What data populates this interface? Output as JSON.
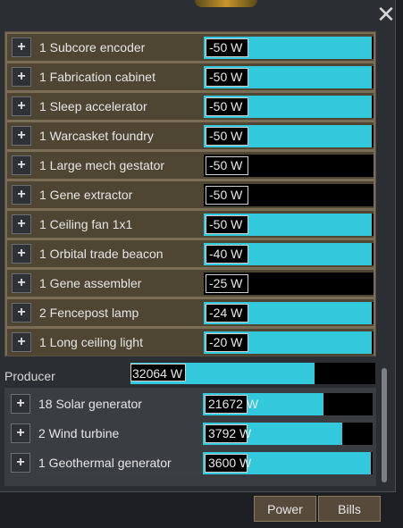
{
  "consumers": [
    {
      "label": "1 Subcore encoder",
      "value": "-50 W",
      "level": 1.0
    },
    {
      "label": "1 Fabrication cabinet",
      "value": "-50 W",
      "level": 1.0
    },
    {
      "label": "1 Sleep accelerator",
      "value": "-50 W",
      "level": 1.0
    },
    {
      "label": "1 Warcasket foundry",
      "value": "-50 W",
      "level": 1.0
    },
    {
      "label": "1 Large mech gestator",
      "value": "-50 W",
      "level": 0.0
    },
    {
      "label": "1 Gene extractor",
      "value": "-50 W",
      "level": 0.0
    },
    {
      "label": "1 Ceiling fan 1x1",
      "value": "-50 W",
      "level": 1.0
    },
    {
      "label": "1 Orbital trade beacon",
      "value": "-40 W",
      "level": 1.0
    },
    {
      "label": "1 Gene assembler",
      "value": "-25 W",
      "level": 0.0
    },
    {
      "label": "2 Fencepost lamp",
      "value": "-24 W",
      "level": 1.0
    },
    {
      "label": "1 Long ceiling light",
      "value": "-20 W",
      "level": 1.0
    }
  ],
  "producer": {
    "label": "Producer",
    "total": "32064 W",
    "total_level": 0.75
  },
  "producers": [
    {
      "label": "18 Solar generator",
      "value": "21672 W",
      "level": 0.72
    },
    {
      "label": "2 Wind turbine",
      "value": "3792 W",
      "level": 0.83
    },
    {
      "label": "1 Geothermal generator",
      "value": "3600 W",
      "level": 1.0
    }
  ],
  "tabs": {
    "power": "Power",
    "bills": "Bills"
  },
  "colors": {
    "bar_fill": "#33c9dc",
    "row_bg": "#4e4533",
    "panel_bg": "#7a6e57"
  },
  "icons": {
    "close": "close-icon",
    "expand": "plus-icon"
  }
}
